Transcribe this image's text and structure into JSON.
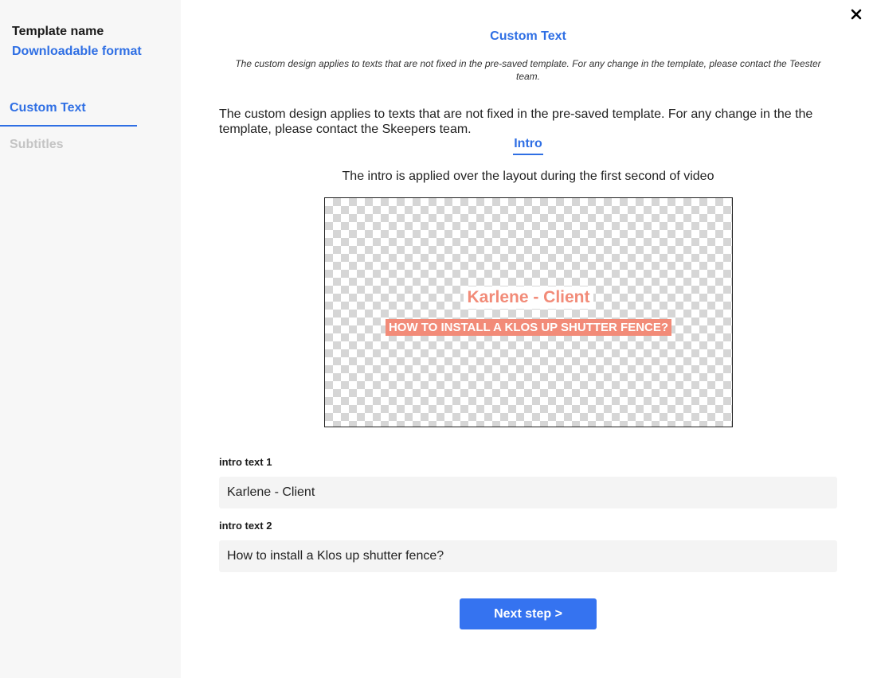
{
  "sidebar": {
    "template_name": "Template name",
    "format": "Downloadable format",
    "tabs": [
      {
        "label": "Custom Text",
        "active": true
      },
      {
        "label": "Subtitles",
        "active": false
      }
    ]
  },
  "close": {
    "icon": "close-icon"
  },
  "main": {
    "title": "Custom Text",
    "italic_note": "The custom design applies to texts that are not fixed in the pre-saved template. For any change in the template, please contact the Teester team.",
    "description": "The custom design applies to texts that are not fixed in the pre-saved template. For any change in the the template, please contact the Skeepers team.",
    "intro_tab": "Intro",
    "intro_description": "The intro is applied over the layout during the first second of video",
    "preview": {
      "line1": "Karlene - Client",
      "line2": "HOW TO INSTALL A KLOS UP SHUTTER FENCE?"
    },
    "fields": [
      {
        "label": "intro text 1",
        "value": "Karlene - Client"
      },
      {
        "label": "intro text 2",
        "value": "How to install a Klos up shutter fence?"
      }
    ],
    "next_button": "Next step >"
  },
  "colors": {
    "accent": "#2f6fe4",
    "button": "#3573f0",
    "preview_text": "#f28b78",
    "sidebar_bg": "#f7f7f7",
    "input_bg": "#f4f4f4"
  }
}
